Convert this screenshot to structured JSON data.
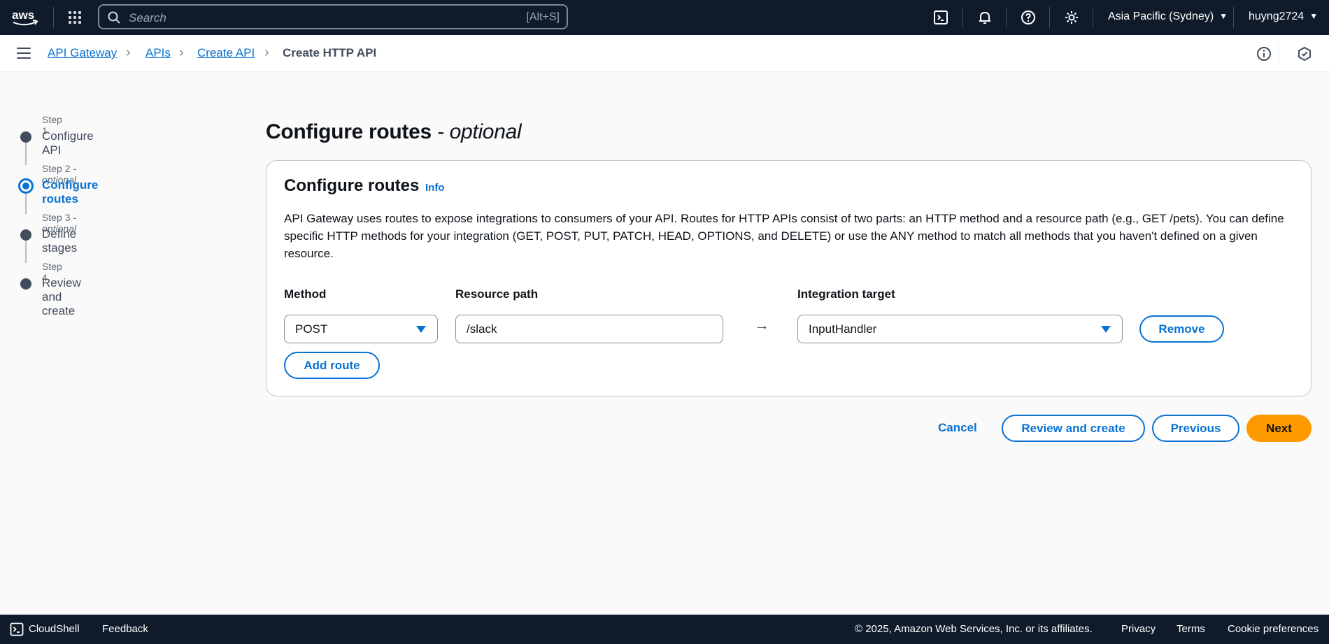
{
  "topnav": {
    "search_placeholder": "Search",
    "search_shortcut": "[Alt+S]",
    "region": "Asia Pacific (Sydney)",
    "user": "huyng2724",
    "icons": [
      "cloudshell-icon",
      "bell-icon",
      "help-icon",
      "gear-icon"
    ]
  },
  "breadcrumb": {
    "items": [
      "API Gateway",
      "APIs",
      "Create API"
    ],
    "current": "Create HTTP API"
  },
  "steps": [
    {
      "label": "Step 1",
      "optional": "",
      "title": "Configure API"
    },
    {
      "label": "Step 2",
      "optional": " - optional",
      "title": "Configure routes"
    },
    {
      "label": "Step 3",
      "optional": " - optional",
      "title": "Define stages"
    },
    {
      "label": "Step 4",
      "optional": "",
      "title": "Review and create"
    }
  ],
  "main": {
    "title": "Configure routes",
    "title_suffix": " - optional",
    "panel_title": "Configure routes",
    "info": "Info",
    "description": "API Gateway uses routes to expose integrations to consumers of your API. Routes for HTTP APIs consist of two parts: an HTTP method and a resource path (e.g., GET /pets). You can define specific HTTP methods for your integration (GET, POST, PUT, PATCH, HEAD, OPTIONS, and DELETE) or use the ANY method to match all methods that you haven't defined on a given resource.",
    "method_label": "Method",
    "path_label": "Resource path",
    "target_label": "Integration target",
    "method_value": "POST",
    "path_value": "/slack",
    "arrow": "→",
    "target_value": "InputHandler",
    "remove": "Remove",
    "add_route": "Add route"
  },
  "actions": {
    "cancel": "Cancel",
    "review": "Review and create",
    "previous": "Previous",
    "next": "Next"
  },
  "footer": {
    "cloudshell": "CloudShell",
    "feedback": "Feedback",
    "copyright": "© 2025, Amazon Web Services, Inc. or its affiliates.",
    "privacy": "Privacy",
    "terms": "Terms",
    "cookies": "Cookie preferences"
  },
  "colors": {
    "nav_bg": "#0f1b2a",
    "link": "#0972d3",
    "primary": "#ff9900"
  }
}
